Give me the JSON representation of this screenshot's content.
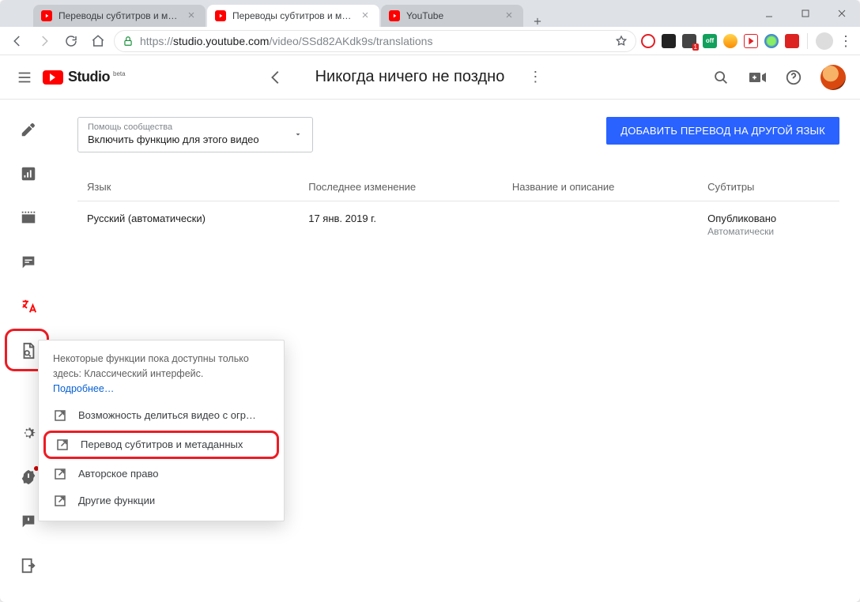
{
  "browser": {
    "tabs": [
      {
        "label": "Переводы субтитров и метадан",
        "active": false
      },
      {
        "label": "Переводы субтитров и метадан",
        "active": true
      },
      {
        "label": "YouTube",
        "active": false
      }
    ],
    "url_prefix": "https://",
    "url_host": "studio.youtube.com",
    "url_path": "/video/SSd82AKdk9s/translations"
  },
  "header": {
    "logo_word": "Studio",
    "logo_beta": "beta",
    "title": "Никогда ничего не поздно"
  },
  "dropdown": {
    "label": "Помощь сообщества",
    "value": "Включить функцию для этого видео"
  },
  "add_button": "ДОБАВИТЬ ПЕРЕВОД НА ДРУГОЙ ЯЗЫК",
  "table": {
    "headers": {
      "lang": "Язык",
      "modified": "Последнее изменение",
      "title_desc": "Название и описание",
      "subs": "Субтитры"
    },
    "rows": [
      {
        "lang": "Русский (автоматически)",
        "modified": "17 янв. 2019 г.",
        "title_desc": "",
        "subs": "Опубликовано",
        "subs_note": "Автоматически"
      }
    ]
  },
  "flyout": {
    "desc": "Некоторые функции пока доступны только здесь: Классический интерфейс.",
    "more": "Подробнее…",
    "items": [
      "Возможность делиться видео с огр…",
      "Перевод субтитров и метаданных",
      "Авторское право",
      "Другие функции"
    ]
  }
}
